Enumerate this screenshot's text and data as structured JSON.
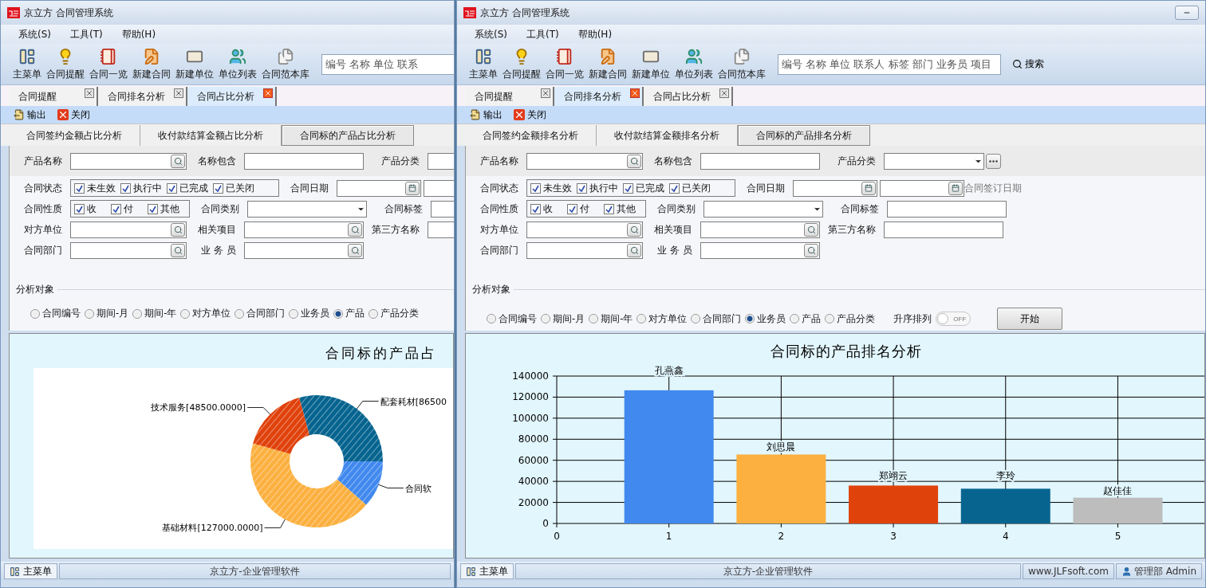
{
  "windows": [
    {
      "title": "京立方 合同管理系统",
      "menu": [
        "系统(S)",
        "工具(T)",
        "帮助(H)"
      ],
      "toolbar": [
        "主菜单",
        "合同提醒",
        "合同一览",
        "新建合同",
        "新建单位",
        "单位列表",
        "合同范本库"
      ],
      "search": {
        "placeholder": "编号 名称 单位 联系"
      },
      "tabs": [
        {
          "label": "合同提醒",
          "selected": false
        },
        {
          "label": "合同排名分析",
          "selected": false
        },
        {
          "label": "合同占比分析",
          "selected": true
        }
      ],
      "actions": [
        "输出",
        "关闭"
      ],
      "sub_tabs": [
        {
          "label": "合同签约金额占比分析",
          "selected": false
        },
        {
          "label": "收付款结算金额占比分析",
          "selected": false
        },
        {
          "label": "合同标的产品占比分析",
          "selected": true
        }
      ],
      "filter_rows": [
        [
          {
            "kind": "search",
            "label": "产品名称"
          },
          {
            "kind": "text",
            "label": "名称包含"
          },
          {
            "kind": "text",
            "label": "产品分类"
          }
        ],
        [
          {
            "kind": "checks",
            "label": "合同状态",
            "items": [
              {
                "label": "未生效",
                "checked": true
              },
              {
                "label": "执行中",
                "checked": true
              },
              {
                "label": "已完成",
                "checked": true
              },
              {
                "label": "已关闭",
                "checked": true
              }
            ]
          },
          {
            "kind": "date",
            "label": "合同日期"
          }
        ],
        [
          {
            "kind": "checks",
            "label": "合同性质",
            "items": [
              {
                "label": "收",
                "checked": true
              },
              {
                "label": "付",
                "checked": true
              },
              {
                "label": "其他",
                "checked": true
              }
            ]
          },
          {
            "kind": "combo",
            "label": "合同类别"
          },
          {
            "kind": "text",
            "label": "合同标签"
          }
        ],
        [
          {
            "kind": "search",
            "label": "对方单位"
          },
          {
            "kind": "search",
            "label": "相关项目"
          },
          {
            "kind": "text",
            "label": "第三方名称"
          }
        ],
        [
          {
            "kind": "search",
            "label": "合同部门"
          },
          {
            "kind": "search",
            "label": "业 务 员"
          }
        ]
      ],
      "analysis": {
        "title": "分析对象",
        "options": [
          {
            "label": "合同编号",
            "selected": false
          },
          {
            "label": "期间-月",
            "selected": false
          },
          {
            "label": "期间-年",
            "selected": false
          },
          {
            "label": "对方单位",
            "selected": false
          },
          {
            "label": "合同部门",
            "selected": false
          },
          {
            "label": "业务员",
            "selected": false
          },
          {
            "label": "产品",
            "selected": true
          },
          {
            "label": "产品分类",
            "selected": false
          }
        ]
      },
      "chart": {
        "chart_data": {
          "type": "donut",
          "title": "合同标的产品占",
          "categories": [
            "合同软",
            "基础材料[127000.0000]",
            "技术服务[48500.0000]",
            "配套耗材[86500"
          ],
          "values": [
            34000,
            127000,
            48500,
            86500
          ]
        }
      },
      "status_bar": [
        {
          "kind": "button",
          "text": "主菜单"
        },
        {
          "kind": "text",
          "text": "京立方-企业管理软件"
        }
      ]
    },
    {
      "title": "京立方 合同管理系统",
      "menu": [
        "系统(S)",
        "工具(T)",
        "帮助(H)"
      ],
      "toolbar": [
        "主菜单",
        "合同提醒",
        "合同一览",
        "新建合同",
        "新建单位",
        "单位列表",
        "合同范本库"
      ],
      "search": {
        "placeholder": "编号 名称 单位 联系人 标签 部门 业务员 项目"
      },
      "search_button": "搜索",
      "tabs": [
        {
          "label": "合同提醒",
          "selected": false
        },
        {
          "label": "合同排名分析",
          "selected": true
        },
        {
          "label": "合同占比分析",
          "selected": false
        }
      ],
      "actions": [
        "输出",
        "关闭"
      ],
      "sub_tabs": [
        {
          "label": "合同签约金额排名分析",
          "selected": false
        },
        {
          "label": "收付款结算金额排名分析",
          "selected": false
        },
        {
          "label": "合同标的产品排名分析",
          "selected": true
        }
      ],
      "filter_rows": [
        [
          {
            "kind": "search",
            "label": "产品名称"
          },
          {
            "kind": "text",
            "label": "名称包含"
          },
          {
            "kind": "combo_more",
            "label": "产品分类"
          }
        ],
        [
          {
            "kind": "checks",
            "label": "合同状态",
            "items": [
              {
                "label": "未生效",
                "checked": true
              },
              {
                "label": "执行中",
                "checked": true
              },
              {
                "label": "已完成",
                "checked": true
              },
              {
                "label": "已关闭",
                "checked": true
              }
            ]
          },
          {
            "kind": "date",
            "label": "合同日期",
            "note": "合同签订日期"
          }
        ],
        [
          {
            "kind": "checks",
            "label": "合同性质",
            "items": [
              {
                "label": "收",
                "checked": true
              },
              {
                "label": "付",
                "checked": true
              },
              {
                "label": "其他",
                "checked": true
              }
            ]
          },
          {
            "kind": "combo",
            "label": "合同类别"
          },
          {
            "kind": "text",
            "label": "合同标签"
          }
        ],
        [
          {
            "kind": "search",
            "label": "对方单位"
          },
          {
            "kind": "search",
            "label": "相关项目"
          },
          {
            "kind": "text",
            "label": "第三方名称"
          }
        ],
        [
          {
            "kind": "search",
            "label": "合同部门"
          },
          {
            "kind": "search",
            "label": "业 务 员"
          }
        ]
      ],
      "analysis": {
        "title": "分析对象",
        "options": [
          {
            "label": "合同编号",
            "selected": false
          },
          {
            "label": "期间-月",
            "selected": false
          },
          {
            "label": "期间-年",
            "selected": false
          },
          {
            "label": "对方单位",
            "selected": false
          },
          {
            "label": "合同部门",
            "selected": false
          },
          {
            "label": "业务员",
            "selected": true
          },
          {
            "label": "产品",
            "selected": false
          },
          {
            "label": "产品分类",
            "selected": false
          }
        ]
      },
      "sort_toggle": {
        "label": "升序排列",
        "text": "OFF",
        "on": false
      },
      "start_button": "开始",
      "chart": {
        "chart_data": {
          "type": "bar",
          "title": "合同标的产品排名分析",
          "x": [
            1,
            2,
            3,
            4,
            5
          ],
          "values": [
            126500,
            65500,
            36000,
            33000,
            24500
          ],
          "value_labels": [
            "孔燕鑫",
            "刘思晨",
            "郑翊云",
            "李玲",
            "赵佳佳"
          ],
          "xticks": [
            0,
            1,
            2,
            3,
            4,
            5
          ],
          "xlim": [
            0,
            5.8
          ],
          "grid": true,
          "yticks": [
            0,
            20000,
            40000,
            60000,
            80000,
            100000,
            120000,
            140000
          ],
          "ylim": [
            0,
            140000
          ]
        }
      },
      "status_bar": [
        {
          "kind": "button",
          "text": "主菜单"
        },
        {
          "kind": "text",
          "text": "京立方-企业管理软件"
        },
        {
          "kind": "link",
          "text": "www.JLFsoft.com"
        },
        {
          "kind": "user",
          "text": "管理部 Admin"
        }
      ]
    }
  ]
}
